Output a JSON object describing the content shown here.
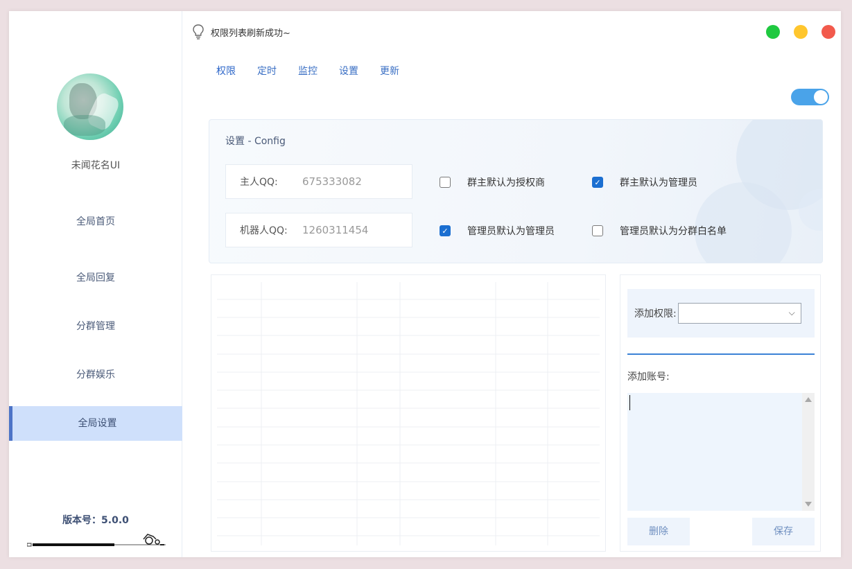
{
  "sidebar": {
    "username": "未闻花名UI",
    "items": [
      {
        "label": "全局首页",
        "active": false
      },
      {
        "label": "全局回复",
        "active": false
      },
      {
        "label": "分群管理",
        "active": false
      },
      {
        "label": "分群娱乐",
        "active": false
      },
      {
        "label": "全局设置",
        "active": true
      }
    ],
    "version": "版本号：5.0.0"
  },
  "status": {
    "icon": "lightbulb-icon",
    "text": "权限列表刷新成功~"
  },
  "window_controls": {
    "colors": [
      "#1fc940",
      "#ffc62d",
      "#f25a4c"
    ]
  },
  "tabs": [
    {
      "label": "权限",
      "active": true
    },
    {
      "label": "定时",
      "active": false
    },
    {
      "label": "监控",
      "active": false
    },
    {
      "label": "设置",
      "active": false
    },
    {
      "label": "更新",
      "active": false
    }
  ],
  "toggle": {
    "on": true,
    "color": "#4aa3e9"
  },
  "config": {
    "title": "设置 - Config",
    "owner_label": "主人QQ:",
    "owner_value": "675333082",
    "bot_label": "机器人QQ:",
    "bot_value": "1260311454",
    "checks": [
      {
        "label": "群主默认为授权商",
        "checked": false
      },
      {
        "label": "群主默认为管理员",
        "checked": true
      },
      {
        "label": "管理员默认为管理员",
        "checked": true
      },
      {
        "label": "管理员默认为分群白名单",
        "checked": false
      }
    ]
  },
  "right": {
    "perm_label": "添加权限:",
    "perm_value": "",
    "acct_label": "添加账号:",
    "acct_value": "",
    "delete_label": "删除",
    "save_label": "保存"
  },
  "colors": {
    "accent": "#2e67c9",
    "active_nav_bg": "#cfe0fb",
    "active_nav_border": "#4d74c7"
  }
}
